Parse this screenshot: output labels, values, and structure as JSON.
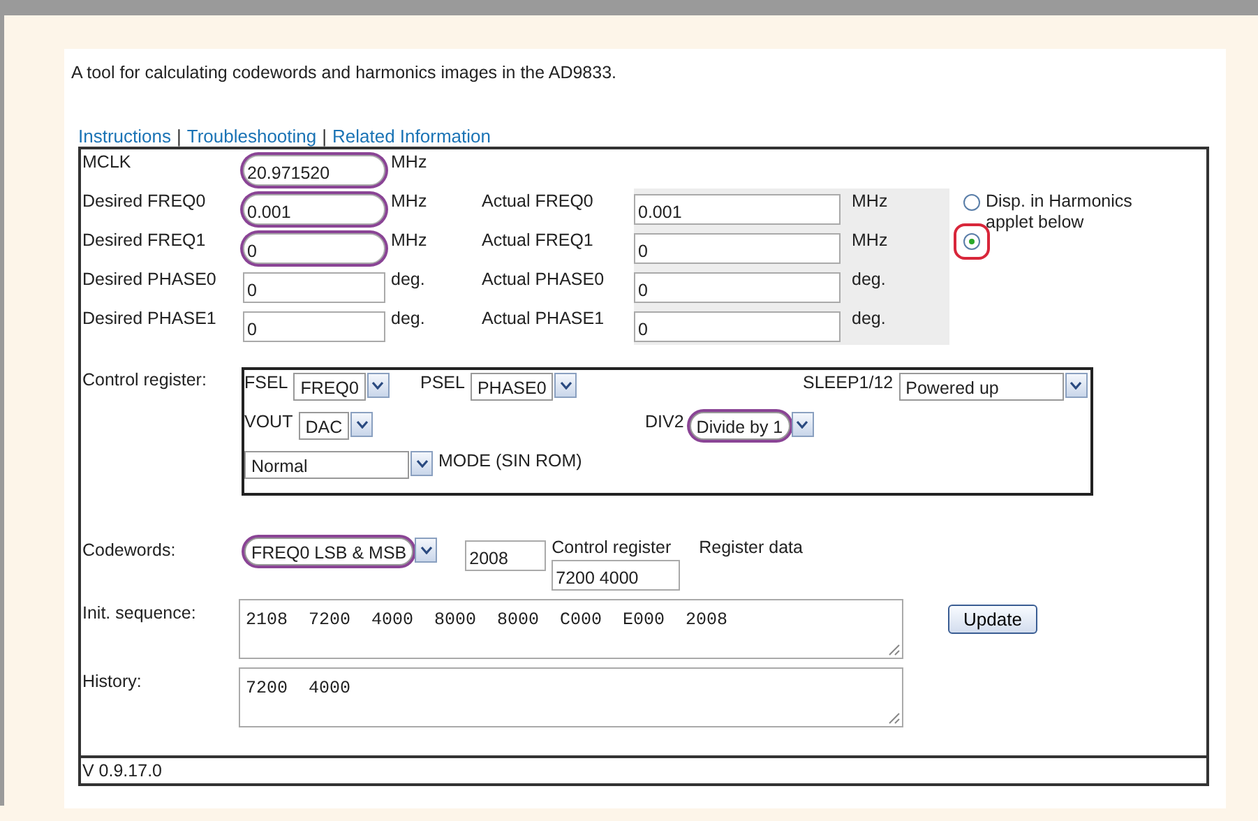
{
  "description": "A tool for calculating codewords and harmonics images in the AD9833.",
  "links": [
    {
      "label": "Instructions"
    },
    {
      "label": "Troubleshooting"
    },
    {
      "label": "Related Information"
    }
  ],
  "link_separators": [
    "|",
    "|"
  ],
  "params": [
    {
      "label": "MCLK",
      "value": "20.971520",
      "unit": "MHz",
      "circled": true
    },
    {
      "label": "Desired FREQ0",
      "value": "0.001",
      "unit": "MHz",
      "circled": true,
      "actual_label": "Actual FREQ0",
      "actual_value": "0.001",
      "actual_unit": "MHz"
    },
    {
      "label": "Desired FREQ1",
      "value": "0",
      "unit": "MHz",
      "circled": true,
      "actual_label": "Actual FREQ1",
      "actual_value": "0",
      "actual_unit": "MHz"
    },
    {
      "label": "Desired PHASE0",
      "value": "0",
      "unit": "deg.",
      "circled": false,
      "actual_label": "Actual PHASE0",
      "actual_value": "0",
      "actual_unit": "deg."
    },
    {
      "label": "Desired PHASE1",
      "value": "0",
      "unit": "deg.",
      "circled": false,
      "actual_label": "Actual PHASE1",
      "actual_value": "0",
      "actual_unit": "deg."
    }
  ],
  "display_option": {
    "label": "Disp. in Harmonics applet below",
    "radios": [
      {
        "selected": false,
        "boxed": false
      },
      {
        "selected": true,
        "boxed": true
      }
    ]
  },
  "control_register": {
    "label": "Control register:",
    "lines": [
      [
        {
          "label": "FSEL",
          "value": "FREQ0",
          "circled": false
        },
        {
          "label": "PSEL",
          "value": "PHASE0",
          "circled": false
        },
        {
          "label": "SLEEP1/12",
          "value": "Powered up",
          "circled": false
        }
      ],
      [
        {
          "label": "VOUT",
          "value": "DAC",
          "circled": false
        },
        {
          "label": "DIV2",
          "value": "Divide by 1",
          "circled": true
        }
      ],
      [
        {
          "label": "MODE (SIN ROM)",
          "value": "Normal",
          "circled": false,
          "kind": "label-after"
        }
      ]
    ]
  },
  "codewords": {
    "label": "Codewords:",
    "value": "FREQ0 LSB & MSB",
    "circled": true,
    "code": "2008",
    "control_register_label": "Control register",
    "register_data_label": "Register data",
    "register_value": "7200 4000"
  },
  "init_sequence": {
    "label": "Init. sequence:",
    "value": "2108  7200  4000  8000  8000  C000  E000  2008"
  },
  "update_button": "Update",
  "history": {
    "label": "History:",
    "value": "7200  4000"
  },
  "version": "V 0.9.17.0"
}
